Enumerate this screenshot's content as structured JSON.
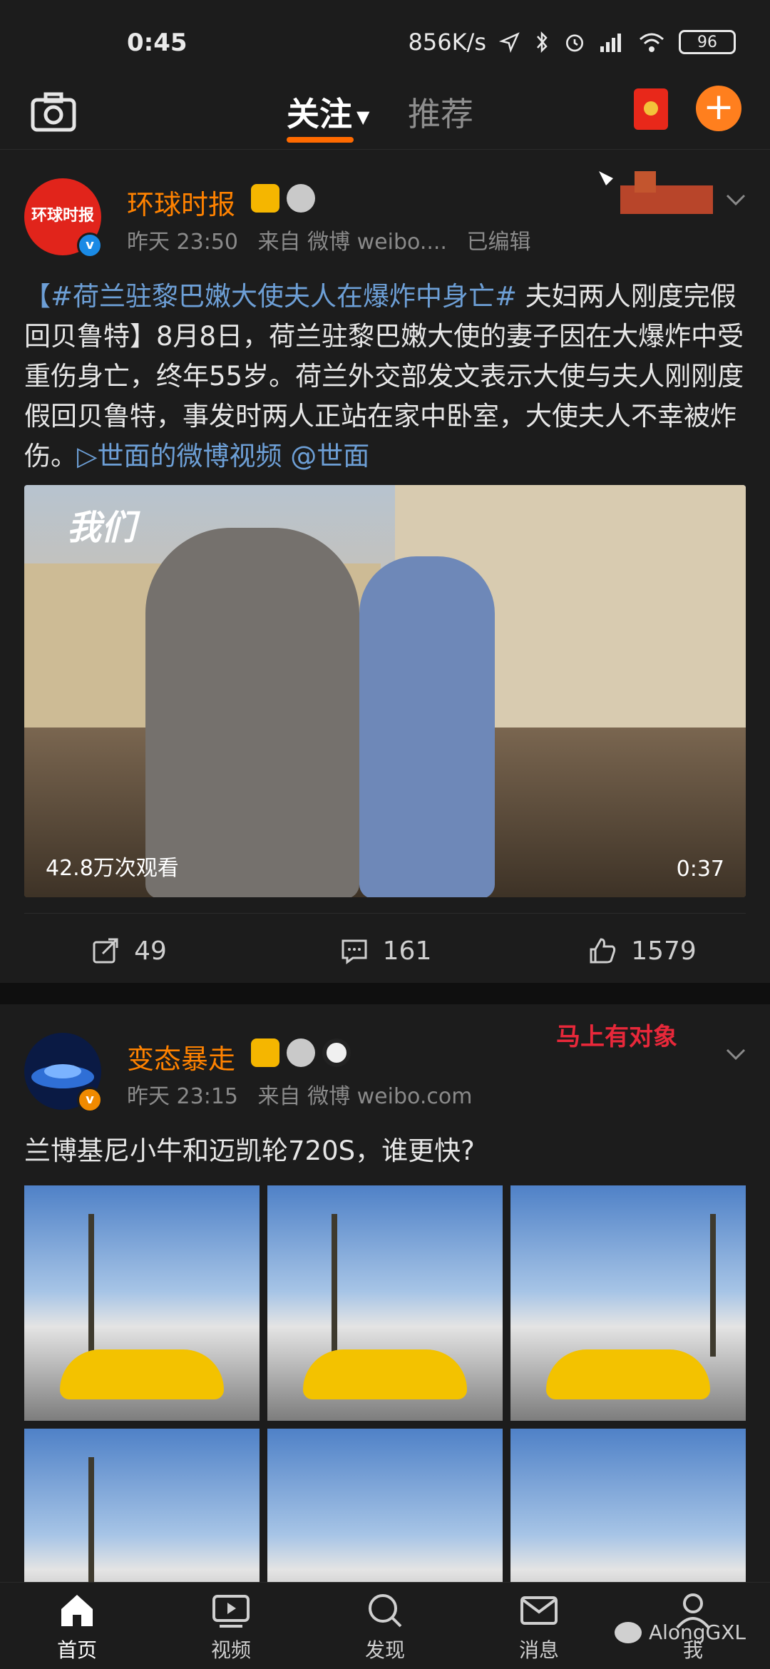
{
  "status_bar": {
    "time": "0:45",
    "net_speed": "856K/s",
    "battery": "96"
  },
  "top_nav": {
    "tab_follow": "关注",
    "tab_recommend": "推荐"
  },
  "posts": [
    {
      "username": "环球时报",
      "avatar_text": "环球时报",
      "time": "昨天 23:50",
      "source": "来自 微博 weibo....",
      "edited": "已编辑",
      "text_tag": "【#荷兰驻黎巴嫩大使夫人在爆炸中身亡#",
      "text_body": " 夫妇两人刚度完假回贝鲁特】8月8日，荷兰驻黎巴嫩大使的妻子因在大爆炸中受重伤身亡，终年55岁。荷兰外交部发文表示大使与夫人刚刚度假回贝鲁特，事发时两人正站在家中卧室，大使夫人不幸被炸伤。",
      "text_link": "▷世面的微博视频 @世面",
      "video_watermark": "我们",
      "video_views": "42.8万次观看",
      "video_duration": "0:37",
      "reposts": "49",
      "comments": "161",
      "likes": "1579"
    },
    {
      "username": "变态暴走",
      "time": "昨天 23:15",
      "source": "来自 微博 weibo.com",
      "text": "兰博基尼小牛和迈凯轮720S，谁更快?",
      "sticker_text": "马上有对象"
    }
  ],
  "bottom_nav": {
    "home": "首页",
    "video": "视频",
    "discover": "发现",
    "messages": "消息",
    "me": "我"
  },
  "watermark": "AlongGXL",
  "colors": {
    "accent": "#ff8200",
    "link": "#6d9fd6",
    "background": "#1c1c1c"
  }
}
